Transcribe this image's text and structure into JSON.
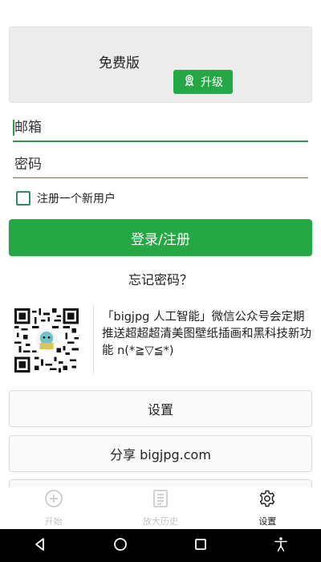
{
  "plan": {
    "label": "免费版",
    "upgrade_label": "升级"
  },
  "form": {
    "email_placeholder": "邮箱",
    "password_placeholder": "密码",
    "register_checkbox_label": "注册一个新用户",
    "submit_label": "登录/注册",
    "forgot_label": "忘记密码？"
  },
  "promo": {
    "text": "「bigjpg 人工智能」微信公众号会定期推送超超超清美图壁纸插画和黑科技新功能 n(*≧▽≦*)"
  },
  "menu": {
    "settings_label": "设置",
    "share_label": "分享 bigjpg.com"
  },
  "tabbar": {
    "items": [
      {
        "label": "开始",
        "icon": "plus-circle-icon",
        "active": false
      },
      {
        "label": "放大历史",
        "icon": "document-list-icon",
        "active": false
      },
      {
        "label": "设置",
        "icon": "gear-icon",
        "active": true
      }
    ]
  },
  "system_nav": {
    "icons": [
      "back-icon",
      "home-icon",
      "recents-icon",
      "accessibility-icon"
    ]
  },
  "colors": {
    "accent": "#25a844",
    "underline": "#2e9b49",
    "checkbox_border": "#2e8c63",
    "nav_bar": "#000000"
  }
}
